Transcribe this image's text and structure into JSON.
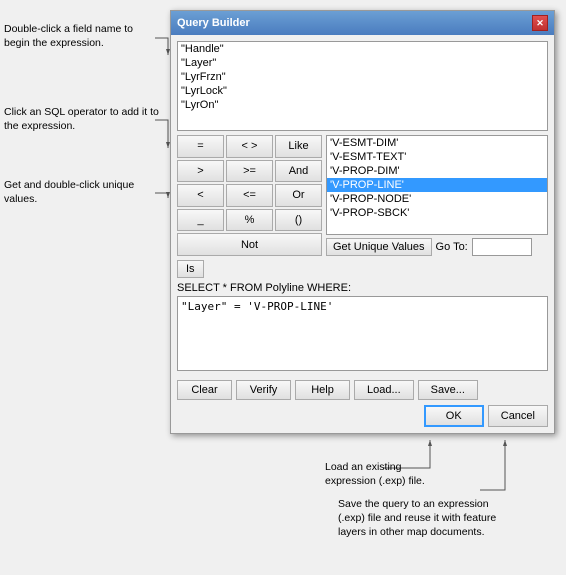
{
  "dialog": {
    "title": "Query Builder",
    "close_label": "✕"
  },
  "fields": {
    "items": [
      {
        "label": "\"Handle\""
      },
      {
        "label": "\"Layer\""
      },
      {
        "label": "\"LyrFrzn\""
      },
      {
        "label": "\"LyrLock\""
      },
      {
        "label": "\"LyrOn\""
      }
    ]
  },
  "operators": [
    {
      "label": "=",
      "name": "equals"
    },
    {
      "label": "< >",
      "name": "not-equals"
    },
    {
      "label": "Like",
      "name": "like"
    },
    {
      "label": ">",
      "name": "greater-than"
    },
    {
      "label": ">=",
      "name": "greater-equal"
    },
    {
      "label": "And",
      "name": "and"
    },
    {
      "label": "<",
      "name": "less-than"
    },
    {
      "label": "<=",
      "name": "less-equal"
    },
    {
      "label": "Or",
      "name": "or"
    },
    {
      "label": "_",
      "name": "underscore"
    },
    {
      "label": "%",
      "name": "percent"
    },
    {
      "label": "()",
      "name": "parens"
    },
    {
      "label": "Not",
      "name": "not"
    }
  ],
  "is_button": {
    "label": "Is"
  },
  "values": {
    "items": [
      {
        "label": "'V-ESMT-DIM'",
        "selected": false
      },
      {
        "label": "'V-ESMT-TEXT'",
        "selected": false
      },
      {
        "label": "'V-PROP-DIM'",
        "selected": false
      },
      {
        "label": "'V-PROP-LINE'",
        "selected": true
      },
      {
        "label": "'V-PROP-NODE'",
        "selected": false
      },
      {
        "label": "'V-PROP-SBCK'",
        "selected": false
      }
    ],
    "get_unique_btn": "Get Unique Values",
    "go_to_label": "Go To:",
    "go_to_value": ""
  },
  "sql": {
    "label": "SELECT * FROM Polyline WHERE:",
    "expression": "\"Layer\" = 'V-PROP-LINE'"
  },
  "buttons": {
    "clear": "Clear",
    "verify": "Verify",
    "help": "Help",
    "load": "Load...",
    "save": "Save...",
    "ok": "OK",
    "cancel": "Cancel"
  },
  "annotations": {
    "field_hint": "Double-click a field name\nto begin the expression.",
    "operator_hint": "Click an SQL operator to\nadd it to the expression.",
    "values_hint": "Get and double-click\nunique values.",
    "load_hint": "Load an existing\nexpression (.exp) file.",
    "save_hint": "Save the query to an expression\n(.exp) file and reuse it with feature\nlayers in other map documents."
  }
}
